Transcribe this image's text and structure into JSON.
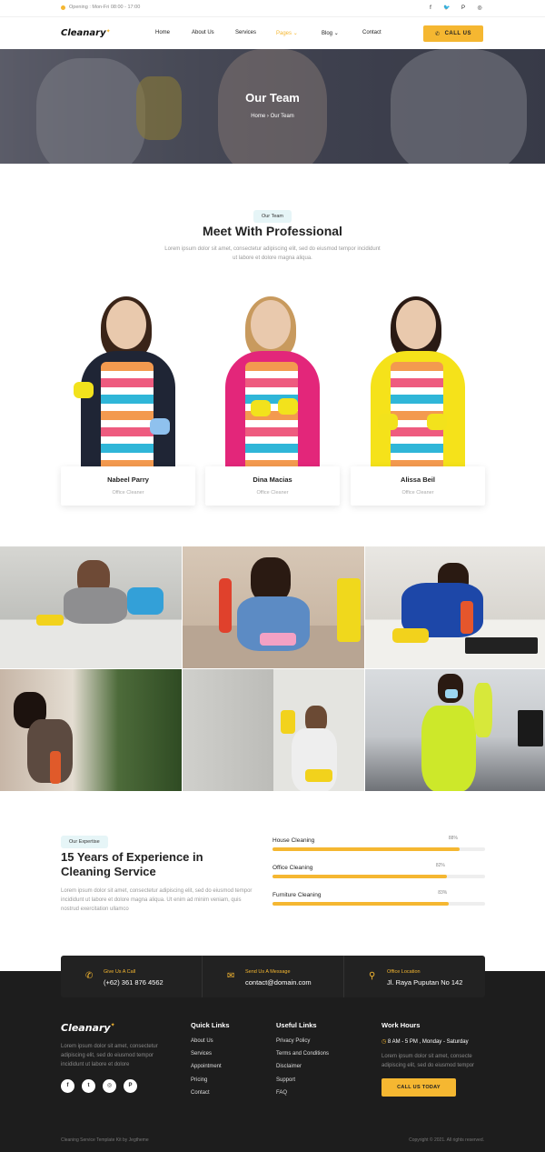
{
  "topbar": {
    "opening": "Opening : Mon-Fri 08:00 - 17:00",
    "socials": [
      "facebook-icon",
      "twitter-icon",
      "pinterest-icon",
      "instagram-icon"
    ]
  },
  "nav": {
    "logo": "Cleanary",
    "items": [
      "Home",
      "About Us",
      "Services",
      "Pages",
      "Blog",
      "Contact"
    ],
    "active": "Pages",
    "call_label": "CALL US"
  },
  "hero": {
    "title": "Our Team",
    "crumb_home": "Home",
    "crumb_current": "Our Team"
  },
  "team": {
    "badge": "Our Team",
    "title": "Meet With Professional",
    "description": "Lorem ipsum dolor sit amet, consectetur adipiscing elit, sed do eiusmod tempor incididunt ut labore et dolore magna aliqua.",
    "members": [
      {
        "name": "Nabeel Parry",
        "role": "Office Cleaner"
      },
      {
        "name": "Dina Macias",
        "role": "Office Cleaner"
      },
      {
        "name": "Alissa Beil",
        "role": "Office Cleaner"
      }
    ]
  },
  "expertise": {
    "badge": "Our Expertise",
    "title": "15 Years of Experience in Cleaning Service",
    "description": "Lorem ipsum dolor sit amet, consectetur adipiscing elit, sed do eiusmod tempor incididunt ut labore et dolore magna aliqua. Ut enim ad minim veniam, quis nostrud exercitation ullamco",
    "skills": [
      {
        "label": "House Cleaning",
        "percent_text": "88%",
        "value": 88
      },
      {
        "label": "Office Cleaning",
        "percent_text": "82%",
        "value": 82
      },
      {
        "label": "Furniture Cleaning",
        "percent_text": "83%",
        "value": 83
      }
    ]
  },
  "contact_strip": [
    {
      "icon": "phone-icon",
      "label": "Give Us A Call",
      "value": "(+62) 361 876 4562"
    },
    {
      "icon": "envelope-icon",
      "label": "Send Us A Message",
      "value": "contact@domain.com"
    },
    {
      "icon": "map-pin-icon",
      "label": "Office Location",
      "value": "Jl. Raya Puputan No 142"
    }
  ],
  "footer": {
    "logo": "Cleanary",
    "description": "Lorem ipsum dolor sit amet, consectetur adipiscing elit, sed do eiusmod tempor incididunt ut labore et dolore",
    "socials": [
      "facebook-icon",
      "twitter-icon",
      "instagram-icon",
      "pinterest-icon"
    ],
    "quick_links_title": "Quick Links",
    "quick_links": [
      "About Us",
      "Services",
      "Appointment",
      "Pricing",
      "Contact"
    ],
    "useful_links_title": "Useful Links",
    "useful_links": [
      "Privacy Policy",
      "Terms and Conditions",
      "Disclaimer",
      "Support",
      "FAQ"
    ],
    "work_hours_title": "Work Hours",
    "work_hours_time": "8 AM - 5 PM , Monday - Saturday",
    "work_hours_desc": "Lorem ipsum dolor sit amet, consecte adipiscing elit, sed do eiusmod tempor",
    "work_hours_button": "CALL US TODAY",
    "bottom_left": "Cleaning Service Template Kit by Jegtheme",
    "bottom_right": "Copyright © 2021. All rights reserved."
  },
  "colors": {
    "accent": "#f5b731",
    "dark": "#1d1d1d",
    "badge_bg": "#e6f5f7"
  }
}
